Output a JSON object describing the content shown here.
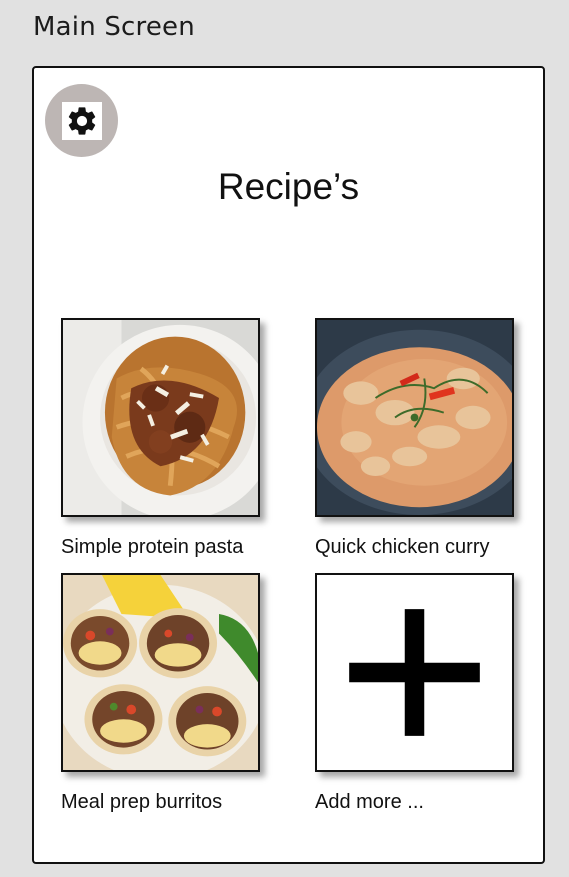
{
  "screen": {
    "label": "Main Screen"
  },
  "header": {
    "title": "Recipe’s",
    "settings_icon": "gear-icon"
  },
  "recipes": [
    {
      "label": "Simple protein pasta",
      "image": "pasta-photo"
    },
    {
      "label": "Quick chicken curry",
      "image": "curry-photo"
    },
    {
      "label": "Meal prep burritos",
      "image": "burritos-photo"
    }
  ],
  "add_more": {
    "label": "Add more ...",
    "icon": "plus-icon"
  }
}
